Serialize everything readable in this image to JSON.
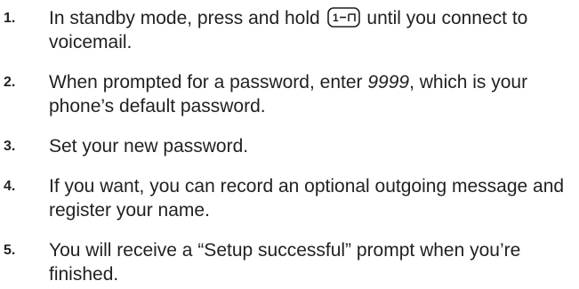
{
  "steps": [
    {
      "number": "1.",
      "text_before_icon": "In standby mode, press and hold",
      "icon": "key-1-voicemail-icon",
      "text_after_icon": "until you connect to voicemail."
    },
    {
      "number": "2.",
      "text_before_emphasis": "When prompted for a password, enter ",
      "emphasis": "9999",
      "text_after_emphasis": ", which is your phone’s default password."
    },
    {
      "number": "3.",
      "text": "Set your new password."
    },
    {
      "number": "4.",
      "text": "If you want, you can record an optional outgoing message and register your name."
    },
    {
      "number": "5.",
      "text": "You will receive a “Setup successful” prompt when you’re finished."
    }
  ]
}
